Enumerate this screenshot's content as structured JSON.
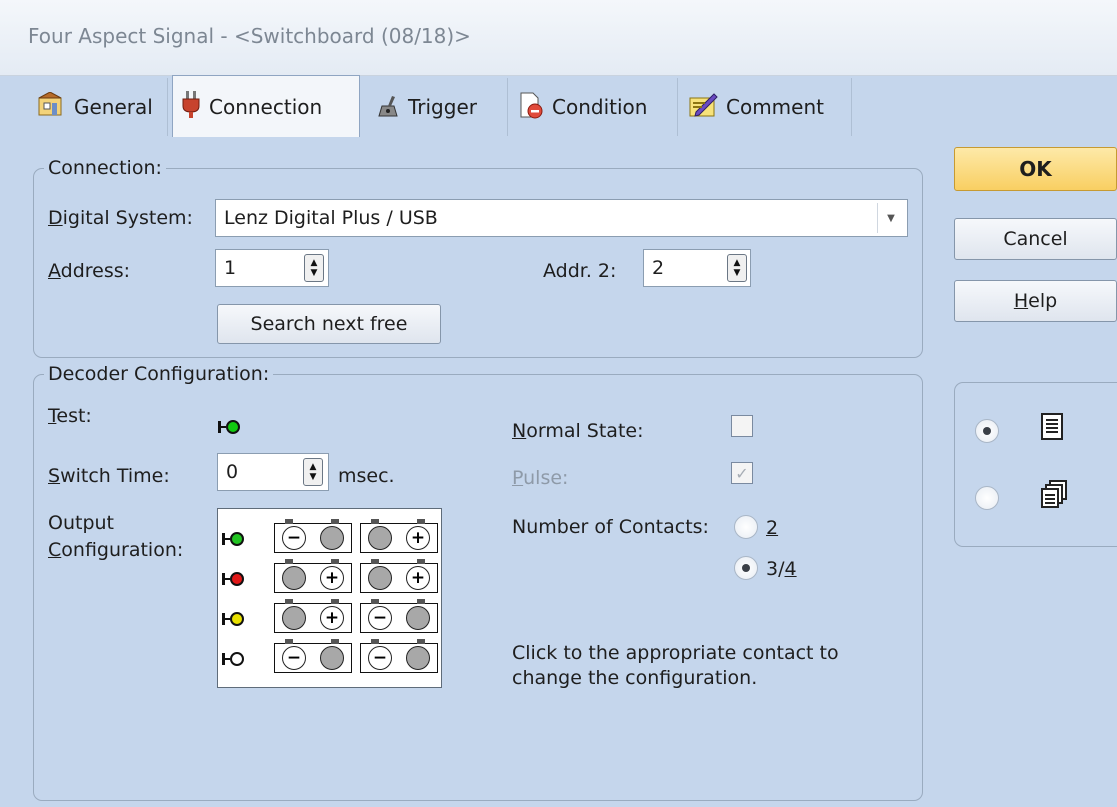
{
  "window": {
    "title": "Four Aspect Signal - <Switchboard (08/18)>"
  },
  "tabs": [
    {
      "label": "General",
      "icon": "general-icon"
    },
    {
      "label": "Connection",
      "icon": "plug-icon"
    },
    {
      "label": "Trigger",
      "icon": "trigger-icon"
    },
    {
      "label": "Condition",
      "icon": "condition-icon"
    },
    {
      "label": "Comment",
      "icon": "comment-icon"
    }
  ],
  "connection": {
    "title": "Connection:",
    "digital_system_label_underlined": "D",
    "digital_system_label_rest": "igital System:",
    "digital_system_value": "Lenz Digital Plus / USB",
    "address_label_underlined": "A",
    "address_label_rest": "ddress:",
    "address_value": "1",
    "addr2_label": "Addr. 2:",
    "addr2_value": "2",
    "search_button": "Search next free"
  },
  "decoder": {
    "title": "Decoder Configuration:",
    "test_label_underlined": "T",
    "test_label_rest": "est:",
    "switch_time_label_underlined": "S",
    "switch_time_label_rest": "witch Time:",
    "switch_time_value": "0",
    "switch_time_unit": "msec.",
    "output_label_line1": "Output",
    "output_label_line2_underlined": "C",
    "output_label_line2_rest": "onfiguration:",
    "normal_state_label_underlined": "N",
    "normal_state_label_rest": "ormal State:",
    "normal_state_checked": false,
    "pulse_label_underlined": "P",
    "pulse_label_rest": "ulse:",
    "pulse_checked": true,
    "contacts_label": "Number of Contacts:",
    "contacts_option_2": "2",
    "contacts_option_34_prefix": "3/",
    "contacts_option_34_underlined": "4",
    "contacts_selected": "3/4",
    "hint_line1": "Click to the appropriate contact to",
    "hint_line2": "change the configuration.",
    "outputs": [
      {
        "aspect": "green",
        "color": "#22c422",
        "pairs": [
          [
            "minus",
            "neutral"
          ],
          [
            "neutral",
            "plus"
          ]
        ]
      },
      {
        "aspect": "red",
        "color": "#e01818",
        "pairs": [
          [
            "neutral",
            "plus"
          ],
          [
            "neutral",
            "plus"
          ]
        ]
      },
      {
        "aspect": "yellow",
        "color": "#e8e000",
        "pairs": [
          [
            "neutral",
            "plus"
          ],
          [
            "minus",
            "neutral"
          ]
        ]
      },
      {
        "aspect": "white",
        "color": "#ffffff",
        "pairs": [
          [
            "minus",
            "neutral"
          ],
          [
            "minus",
            "neutral"
          ]
        ]
      }
    ]
  },
  "buttons": {
    "ok": "OK",
    "cancel": "Cancel",
    "help_underlined": "H",
    "help_rest": "elp"
  },
  "view_mode": {
    "selected": "list",
    "options": [
      "list-view-icon",
      "copy-view-icon"
    ]
  },
  "colors": {
    "ok_button": "#fbd97a",
    "background": "#c5d6ec",
    "test_led": "#11c911"
  }
}
